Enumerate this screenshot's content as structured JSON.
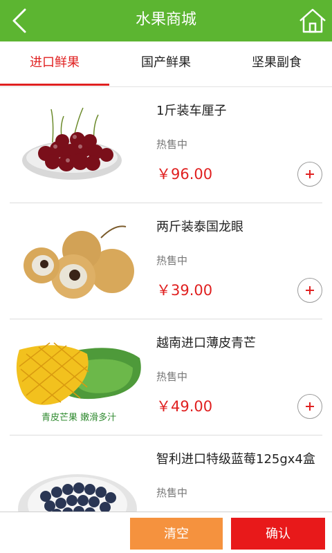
{
  "header": {
    "title": "水果商城",
    "back_icon": "chevron-left-icon",
    "home_icon": "home-icon",
    "bar_color": "#5cb531"
  },
  "tabs": [
    {
      "label": "进口鲜果",
      "active": true
    },
    {
      "label": "国产鲜果",
      "active": false
    },
    {
      "label": "坚果副食",
      "active": false
    }
  ],
  "products": [
    {
      "name": "1斤装车厘子",
      "status": "热售中",
      "price": "￥96.00"
    },
    {
      "name": "两斤装泰国龙眼",
      "status": "热售中",
      "price": "￥39.00"
    },
    {
      "name": "越南进口薄皮青芒",
      "status": "热售中",
      "price": "￥49.00",
      "image_caption": "青皮芒果  嫩滑多汁"
    },
    {
      "name": "智利进口特级蓝莓125gx4盒",
      "status": "热售中"
    }
  ],
  "actions": {
    "clear_label": "清空",
    "confirm_label": "确认"
  },
  "colors": {
    "accent_red": "#e02020",
    "clear_button": "#f5923e",
    "confirm_button": "#e8191a"
  }
}
